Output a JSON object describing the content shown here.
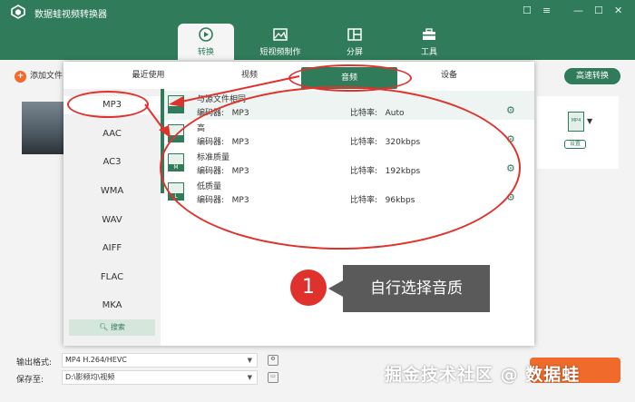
{
  "app": {
    "title": "数据蛙视频转换器"
  },
  "nav_tabs": [
    {
      "label": "转换",
      "icon": "convert-icon"
    },
    {
      "label": "短视频制作",
      "icon": "image-icon"
    },
    {
      "label": "分屏",
      "icon": "split-screen-icon"
    },
    {
      "label": "工具",
      "icon": "toolbox-icon"
    }
  ],
  "toolbar": {
    "add_file": "添加文件",
    "fast_convert": "高速转换"
  },
  "popup": {
    "tabs": [
      "最近使用",
      "视频",
      "音频",
      "设备"
    ],
    "active_tab": "音频",
    "formats": [
      "MP3",
      "AAC",
      "AC3",
      "WMA",
      "WAV",
      "AIFF",
      "FLAC",
      "MKA"
    ],
    "selected_format": "MP3",
    "search_label": "搜索",
    "qualities": [
      {
        "name": "与源文件相同",
        "encoder_label": "编码器:",
        "encoder": "MP3",
        "bitrate_label": "比特率:",
        "bitrate": "Auto",
        "badge": ""
      },
      {
        "name": "高",
        "encoder_label": "编码器:",
        "encoder": "MP3",
        "bitrate_label": "比特率:",
        "bitrate": "320kbps",
        "badge": ""
      },
      {
        "name": "标准质量",
        "encoder_label": "编码器:",
        "encoder": "MP3",
        "bitrate_label": "比特率:",
        "bitrate": "192kbps",
        "badge": "M"
      },
      {
        "name": "低质量",
        "encoder_label": "编码器:",
        "encoder": "MP3",
        "bitrate_label": "比特率:",
        "bitrate": "96kbps",
        "badge": "L"
      }
    ]
  },
  "right_panel": {
    "format_badge": "MP4",
    "settings_label": "设置"
  },
  "bottom": {
    "output_label": "输出格式:",
    "output_value": "MP4 H.264/HEVC",
    "save_label": "保存至:",
    "save_value": "D:\\影频均\\视频"
  },
  "annotation": {
    "step": "1",
    "tip": "自行选择音质"
  },
  "watermark": "掘金技术社区 @ 数据蛙",
  "colors": {
    "brand": "#2f7b5a",
    "accent": "#f06a2b",
    "annotation": "#e0322d"
  }
}
